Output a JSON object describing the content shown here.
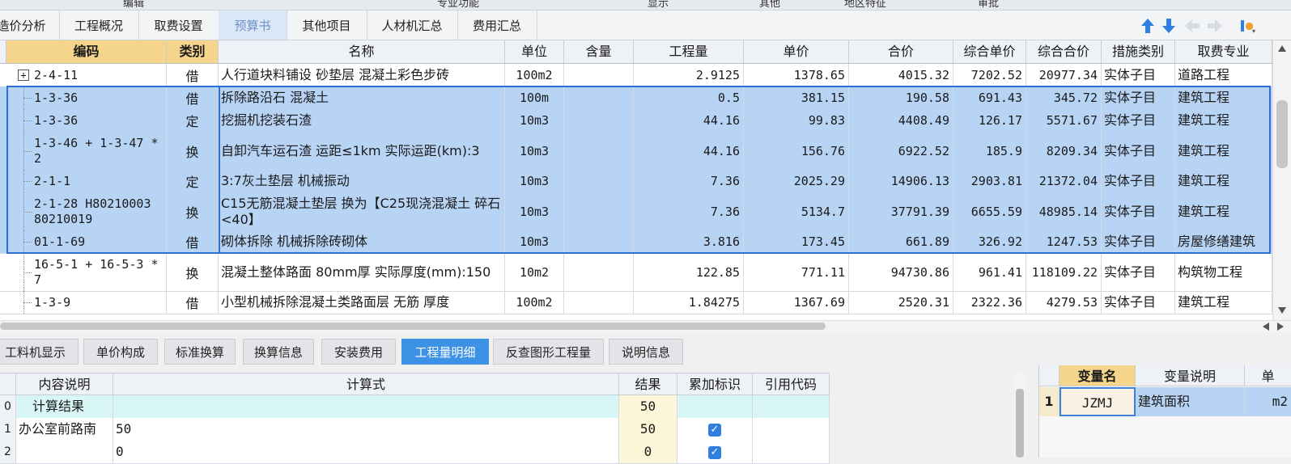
{
  "menu_strip": [
    "编辑",
    "专业功能",
    "显示",
    "其他",
    "地区特征",
    "审批"
  ],
  "tabs": [
    {
      "label": "造价分析",
      "active": false
    },
    {
      "label": "工程概况",
      "active": false
    },
    {
      "label": "取费设置",
      "active": false
    },
    {
      "label": "预算书",
      "active": true
    },
    {
      "label": "其他项目",
      "active": false
    },
    {
      "label": "人材机汇总",
      "active": false
    },
    {
      "label": "费用汇总",
      "active": false
    }
  ],
  "toolbar_icons": [
    "arrow-up-icon",
    "arrow-down-icon",
    "arrow-left-icon",
    "arrow-right-icon",
    "settings-icon"
  ],
  "grid": {
    "headers": [
      "编码",
      "类别",
      "名称",
      "单位",
      "含量",
      "工程量",
      "单价",
      "合价",
      "综合单价",
      "综合合价",
      "措施类别",
      "取费专业"
    ],
    "rows": [
      {
        "code": "2-4-11",
        "type": "借",
        "name": "人行道块料铺设 砂垫层 混凝土彩色步砖",
        "unit": "100m2",
        "content": "",
        "qty": "2.9125",
        "price": "1378.65",
        "total": "4015.32",
        "comp_price": "7202.52",
        "comp_total": "20977.34",
        "measure": "实体子目",
        "fee": "道路工程",
        "selected": false,
        "expander": true
      },
      {
        "code": "1-3-36",
        "type": "借",
        "name": "拆除路沿石 混凝土",
        "unit": "100m",
        "content": "",
        "qty": "0.5",
        "price": "381.15",
        "total": "190.58",
        "comp_price": "691.43",
        "comp_total": "345.72",
        "measure": "实体子目",
        "fee": "建筑工程",
        "selected": true
      },
      {
        "code": "1-3-36",
        "type": "定",
        "name": "挖掘机挖装石渣",
        "unit": "10m3",
        "content": "",
        "qty": "44.16",
        "price": "99.83",
        "total": "4408.49",
        "comp_price": "126.17",
        "comp_total": "5571.67",
        "measure": "实体子目",
        "fee": "建筑工程",
        "selected": true
      },
      {
        "code": "1-3-46 + 1-3-47 * 2",
        "type": "换",
        "name": "自卸汽车运石渣 运距≤1km  实际运距(km):3",
        "unit": "10m3",
        "content": "",
        "qty": "44.16",
        "price": "156.76",
        "total": "6922.52",
        "comp_price": "185.9",
        "comp_total": "8209.34",
        "measure": "实体子目",
        "fee": "建筑工程",
        "selected": true
      },
      {
        "code": "2-1-1",
        "type": "定",
        "name": "3:7灰土垫层 机械振动",
        "unit": "10m3",
        "content": "",
        "qty": "7.36",
        "price": "2025.29",
        "total": "14906.13",
        "comp_price": "2903.81",
        "comp_total": "21372.04",
        "measure": "实体子目",
        "fee": "建筑工程",
        "selected": true
      },
      {
        "code": "2-1-28 H80210003 80210019",
        "type": "换",
        "name": "C15无筋混凝土垫层  换为【C25现浇混凝土 碎石<40】",
        "unit": "10m3",
        "content": "",
        "qty": "7.36",
        "price": "5134.7",
        "total": "37791.39",
        "comp_price": "6655.59",
        "comp_total": "48985.14",
        "measure": "实体子目",
        "fee": "建筑工程",
        "selected": true
      },
      {
        "code": "01-1-69",
        "type": "借",
        "name": "砌体拆除 机械拆除砖砌体",
        "unit": "10m3",
        "content": "",
        "qty": "3.816",
        "price": "173.45",
        "total": "661.89",
        "comp_price": "326.92",
        "comp_total": "1247.53",
        "measure": "实体子目",
        "fee": "房屋修缮建筑",
        "selected": true
      },
      {
        "code": "16-5-1 + 16-5-3 * 7",
        "type": "换",
        "name": "混凝土整体路面 80mm厚  实际厚度(mm):150",
        "unit": "10m2",
        "content": "",
        "qty": "122.85",
        "price": "771.11",
        "total": "94730.86",
        "comp_price": "961.41",
        "comp_total": "118109.22",
        "measure": "实体子目",
        "fee": "构筑物工程",
        "selected": false
      },
      {
        "code": "1-3-9",
        "type": "借",
        "name": "小型机械拆除混凝土类路面层 无筋 厚度",
        "unit": "100m2",
        "content": "",
        "qty": "1.84275",
        "price": "1367.69",
        "total": "2520.31",
        "comp_price": "2322.36",
        "comp_total": "4279.53",
        "measure": "实体子目",
        "fee": "建筑工程",
        "selected": false
      }
    ]
  },
  "bottom_tabs": [
    {
      "label": "工料机显示",
      "active": false
    },
    {
      "label": "单价构成",
      "active": false
    },
    {
      "label": "标准换算",
      "active": false
    },
    {
      "label": "换算信息",
      "active": false
    },
    {
      "label": "安装费用",
      "active": false
    },
    {
      "label": "工程量明细",
      "active": true
    },
    {
      "label": "反查图形工程量",
      "active": false
    },
    {
      "label": "说明信息",
      "active": false
    }
  ],
  "detail": {
    "headers": [
      "内容说明",
      "计算式",
      "结果",
      "累加标识",
      "引用代码"
    ],
    "rows": [
      {
        "idx": "0",
        "desc": "计算结果",
        "formula": "",
        "result": "50",
        "checked": false,
        "ref": ""
      },
      {
        "idx": "1",
        "desc": "办公室前路南",
        "formula": "50",
        "result": "50",
        "checked": true,
        "ref": ""
      },
      {
        "idx": "2",
        "desc": "",
        "formula": "0",
        "result": "0",
        "checked": true,
        "ref": ""
      }
    ]
  },
  "variables": {
    "headers": [
      "变量名",
      "变量说明",
      "单"
    ],
    "rows": [
      {
        "idx": "1",
        "name": "JZMJ",
        "desc": "建筑面积",
        "unit": "m2"
      }
    ]
  }
}
